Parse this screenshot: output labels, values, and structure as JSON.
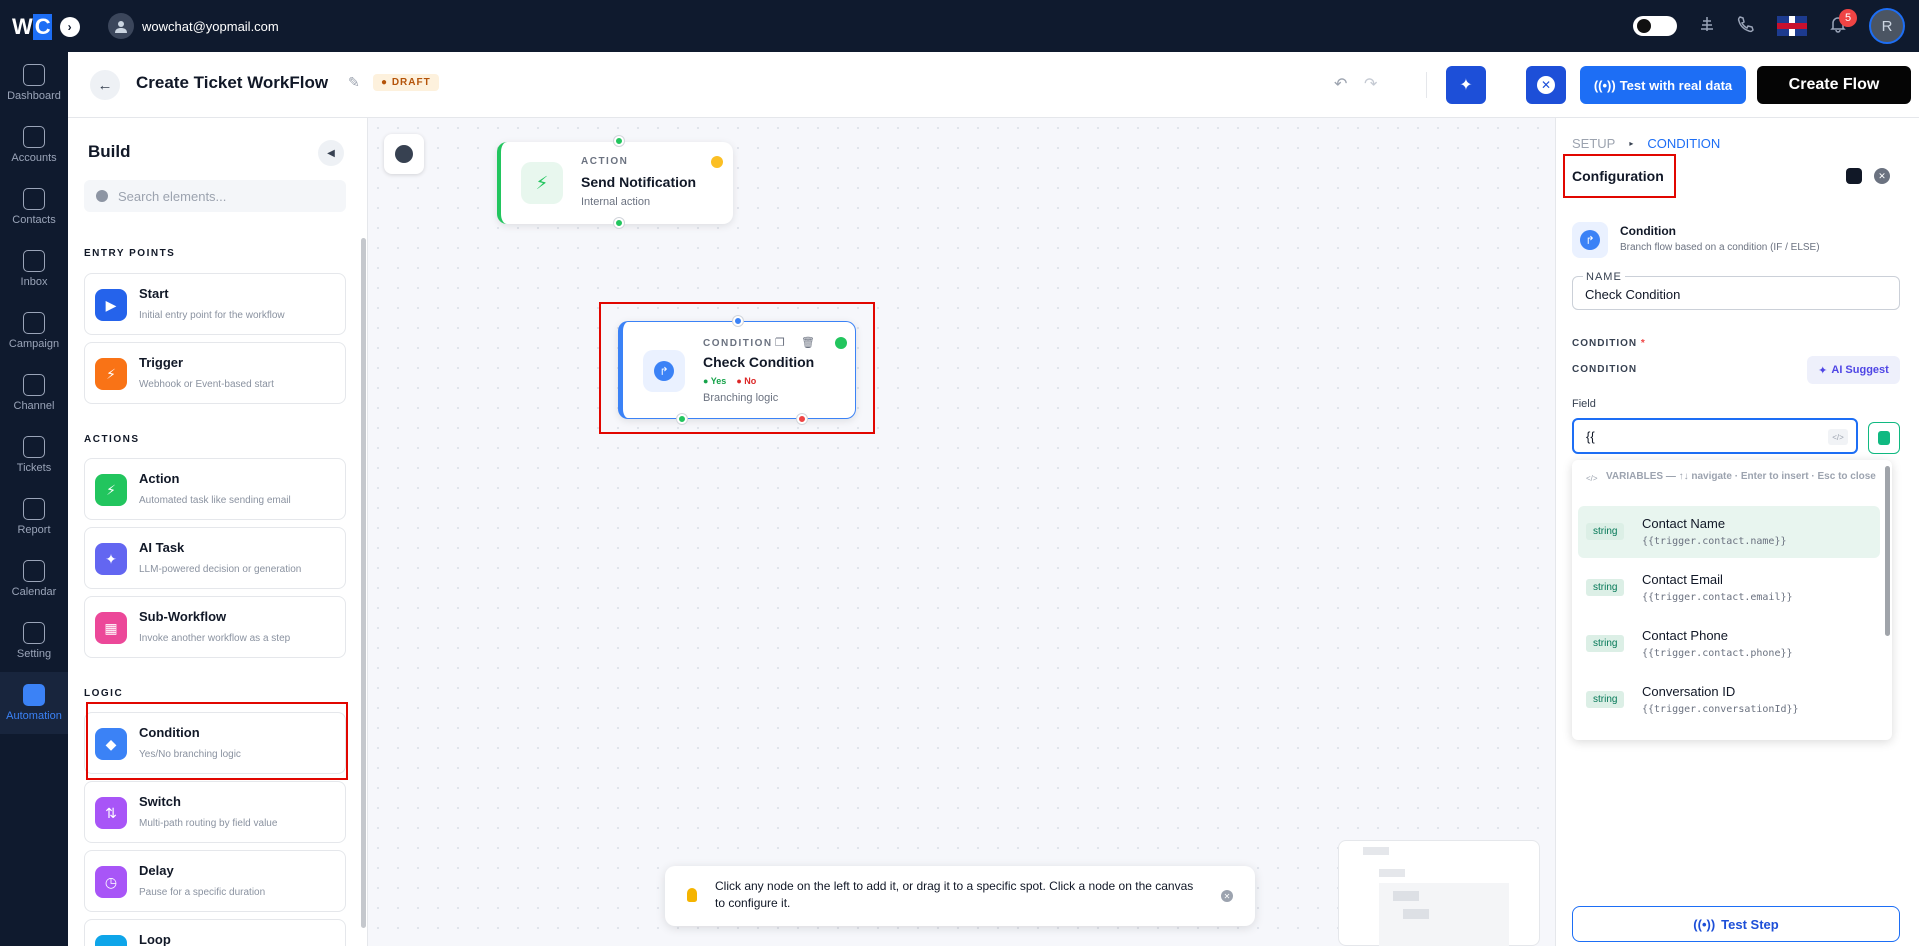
{
  "topbar": {
    "logo_text": "WC",
    "user_email": "wowchat@yopmail.com",
    "notification_count": "5",
    "avatar_initial": "R"
  },
  "nav": [
    {
      "label": "Dashboard",
      "icon": "dashboard-icon"
    },
    {
      "label": "Accounts",
      "icon": "home-icon"
    },
    {
      "label": "Contacts",
      "icon": "contacts-icon"
    },
    {
      "label": "Inbox",
      "icon": "inbox-icon"
    },
    {
      "label": "Campaign",
      "icon": "megaphone-icon"
    },
    {
      "label": "Channel",
      "icon": "channel-icon"
    },
    {
      "label": "Tickets",
      "icon": "ticket-icon"
    },
    {
      "label": "Report",
      "icon": "report-icon"
    },
    {
      "label": "Calendar",
      "icon": "calendar-icon"
    },
    {
      "label": "Setting",
      "icon": "gear-icon"
    },
    {
      "label": "Automation",
      "icon": "automation-icon",
      "active": true
    }
  ],
  "header": {
    "title": "Create Ticket WorkFlow",
    "status": "DRAFT",
    "test_real_label": "Test with real data",
    "create_flow_label": "Create Flow"
  },
  "build": {
    "title": "Build",
    "search_placeholder": "Search elements...",
    "sections": {
      "entry": "ENTRY POINTS",
      "actions": "ACTIONS",
      "logic": "LOGIC"
    },
    "items": {
      "start": {
        "name": "Start",
        "desc": "Initial entry point for the workflow",
        "color": "#2563eb"
      },
      "trigger": {
        "name": "Trigger",
        "desc": "Webhook or Event-based start",
        "color": "#f97316"
      },
      "action": {
        "name": "Action",
        "desc": "Automated task like sending email",
        "color": "#22c55e"
      },
      "ai_task": {
        "name": "AI Task",
        "desc": "LLM-powered decision or generation",
        "color": "#6366f1"
      },
      "sub_workflow": {
        "name": "Sub-Workflow",
        "desc": "Invoke another workflow as a step",
        "color": "#ec4899"
      },
      "condition": {
        "name": "Condition",
        "desc": "Yes/No branching logic",
        "color": "#3b82f6"
      },
      "switch": {
        "name": "Switch",
        "desc": "Multi-path routing by field value",
        "color": "#a855f7"
      },
      "delay": {
        "name": "Delay",
        "desc": "Pause for a specific duration",
        "color": "#a855f7"
      },
      "loop": {
        "name": "Loop",
        "desc": "",
        "color": "#0ea5e9"
      }
    }
  },
  "canvas": {
    "node_action": {
      "type": "ACTION",
      "title": "Send Notification",
      "sub": "Internal action"
    },
    "node_condition": {
      "type": "CONDITION",
      "title": "Check Condition",
      "yes": "Yes",
      "no": "No",
      "sub": "Branching logic"
    },
    "tip_text": "Click any node on the left to add it, or drag it to a specific spot. Click a node on the canvas to configure it."
  },
  "config": {
    "crumb_setup": "SETUP",
    "crumb_condition": "CONDITION",
    "title": "Configuration",
    "node_title": "Condition",
    "node_desc": "Branch flow based on a condition (IF / ELSE)",
    "name_label": "NAME",
    "name_value": "Check Condition",
    "condition_label": "CONDITION",
    "condition_required": "*",
    "condition_sub": "CONDITION",
    "ai_suggest": "AI Suggest",
    "field_label": "Field",
    "field_value": "{{",
    "dropdown_head": "VARIABLES — ↑↓ navigate · Enter to insert · Esc to close",
    "variables": [
      {
        "type": "string",
        "name": "Contact Name",
        "path": "{{trigger.contact.name}}"
      },
      {
        "type": "string",
        "name": "Contact Email",
        "path": "{{trigger.contact.email}}"
      },
      {
        "type": "string",
        "name": "Contact Phone",
        "path": "{{trigger.contact.phone}}"
      },
      {
        "type": "string",
        "name": "Conversation ID",
        "path": "{{trigger.conversationId}}"
      }
    ],
    "test_step": "Test Step"
  }
}
